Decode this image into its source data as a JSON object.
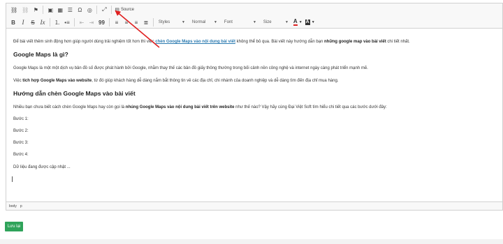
{
  "toolbar": {
    "source_label": "Source",
    "styles_label": "Styles",
    "format_label": "Normal",
    "font_label": "Font",
    "size_label": "Size",
    "text_color_letter": "A",
    "bg_color_letter": "A",
    "bold_label": "B",
    "italic_label": "I",
    "strike_label": "S",
    "quote_label": "99"
  },
  "content": {
    "intro_pre": "Để bài viết thêm sinh động hơn giúp người dùng trải nghiệm tốt hơn thì việc ",
    "intro_link": "chèn Google Maps vào nội dung bài viết",
    "intro_mid": " không thể bỏ qua. Bài viết này hướng dẫn bạn ",
    "intro_bold": "những google map vào bài viết",
    "intro_post": " chi tiết nhất.",
    "h1": "Google Maps là gì?",
    "p1": "Google Maps là một một dịch vụ bản đồ số được phát hành bởi Google, nhằm thay thế các bản đồ giấy thông thường trong bối cảnh nền công nghệ và internet ngày càng phát triển mạnh mẽ.",
    "p2_pre": "Việc ",
    "p2_bold": "tích hợp Google Maps vào website",
    "p2_post": ", từ đó giúp khách hàng dễ dàng nắm bắt thông tin về các địa chỉ, chi nhánh của doanh nghiệp và dễ dàng tìm đến địa chỉ mua hàng.",
    "h2": "Hướng dẫn chèn Google Maps vào bài viết",
    "p3_pre": "Nhiều bạn chưa biết cách chèn Google Maps hay còn gọi là ",
    "p3_bold": "nhúng Google Maps vào nội dung bài viết trên website",
    "p3_post": " như thế nào? Vậy hãy cùng Đại Việt Soft tìm hiểu chi tiết qua các bước dưới đây:",
    "step1": "Bước 1:",
    "step2": "Bước 2:",
    "step3": "Bước 3:",
    "step4": "Bước 4:",
    "updating": "Dữ liệu đang được cập nhật ..."
  },
  "statusbar": {
    "path1": "body",
    "path2": "p"
  },
  "save_label": "Lưu lại",
  "colors": {
    "save": "#2fa35a",
    "annotation_arrow": "#e02020",
    "link": "#2a7ab0"
  }
}
